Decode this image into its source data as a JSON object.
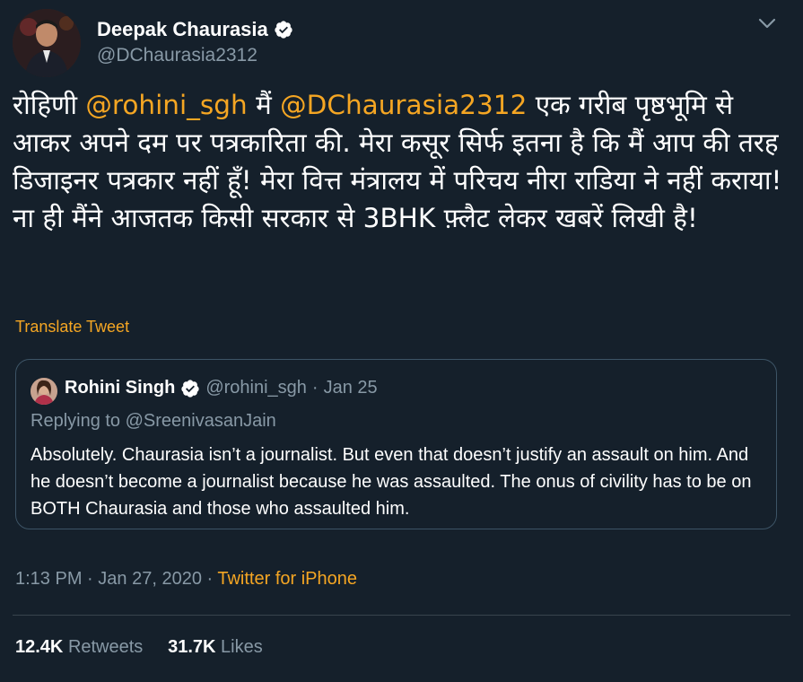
{
  "author": {
    "name": "Deepak Chaurasia",
    "handle": "@DChaurasia2312",
    "verified_icon": "verified-badge-icon",
    "avatar_icon": "avatar"
  },
  "tweet": {
    "segments": [
      {
        "text": "रोहिणी ",
        "type": "text"
      },
      {
        "text": "@rohini_sgh",
        "type": "mention"
      },
      {
        "text": " मैं ",
        "type": "text"
      },
      {
        "text": "@DChaurasia2312",
        "type": "mention"
      },
      {
        "text": " एक गरीब पृष्ठभूमि से आकर अपने दम पर पत्रकारिता की. मेरा कसूर सिर्फ इतना है कि मैं आप की तरह डिजाइनर पत्रकार नहीं हूँ! मेरा वित्त मंत्रालय में परिचय नीरा राडिया ने नहीं कराया! ना ही मैंने आजतक किसी सरकार से 3BHK फ़्लैट लेकर खबरें लिखी है!",
        "type": "text"
      }
    ],
    "translate_label": "Translate Tweet"
  },
  "quoted": {
    "name": "Rohini Singh",
    "handle": "@rohini_sgh",
    "separator": "·",
    "date": "Jan 25",
    "replying_to": "Replying to @SreenivasanJain",
    "text": "Absolutely. Chaurasia isn’t a journalist. But even that doesn’t justify an assault on him. And he doesn’t become a journalist because he was assaulted. The onus of civility has to be on BOTH Chaurasia and those who assaulted him."
  },
  "meta": {
    "time": "1:13 PM",
    "separator1": "·",
    "date": "Jan 27, 2020",
    "separator2": "·",
    "source": "Twitter for iPhone"
  },
  "stats": {
    "retweets_count": "12.4K",
    "retweets_label": "Retweets",
    "likes_count": "31.7K",
    "likes_label": "Likes"
  },
  "colors": {
    "background": "#15202b",
    "accent": "#f5a623",
    "muted": "#8899a6",
    "border": "#3d5466"
  }
}
